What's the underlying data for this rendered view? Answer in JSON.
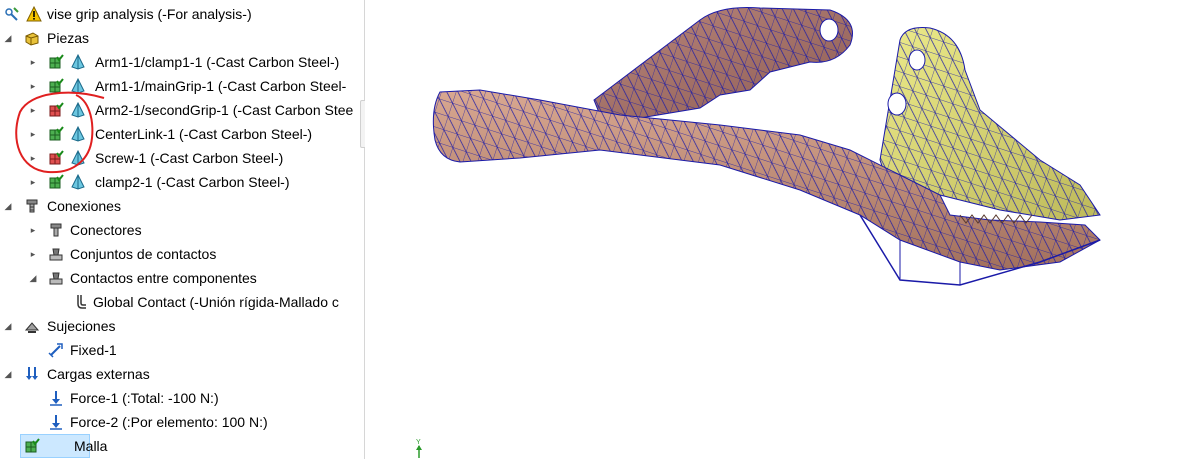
{
  "tree": {
    "root": "vise grip analysis (-For analysis-)",
    "parts": {
      "label": "Piezas",
      "items": [
        "Arm1-1/clamp1-1 (-Cast Carbon Steel-)",
        "Arm1-1/mainGrip-1 (-Cast Carbon Steel-",
        "Arm2-1/secondGrip-1 (-Cast Carbon Stee",
        "CenterLink-1 (-Cast Carbon Steel-)",
        "Screw-1 (-Cast Carbon Steel-)",
        "clamp2-1 (-Cast Carbon Steel-)"
      ]
    },
    "connections": {
      "label": "Conexiones",
      "connectors": "Conectores",
      "contact_sets": "Conjuntos de contactos",
      "component_contacts": "Contactos entre componentes",
      "global_contact": "Global Contact (-Unión rígida-Mallado c"
    },
    "fixtures": {
      "label": "Sujeciones",
      "fixed": "Fixed-1"
    },
    "loads": {
      "label": "Cargas externas",
      "force1": "Force-1 (:Total: -100 N:)",
      "force2": "Force-2 (:Por elemento: 100 N:)"
    },
    "mesh": "Malla"
  },
  "viewport": {
    "triad_axis": "Y",
    "mesh_color": "#1a1aa8",
    "body_color": "#c8967f",
    "jaw_color": "#e6e27a"
  },
  "annotation": {
    "color": "#e02020"
  }
}
